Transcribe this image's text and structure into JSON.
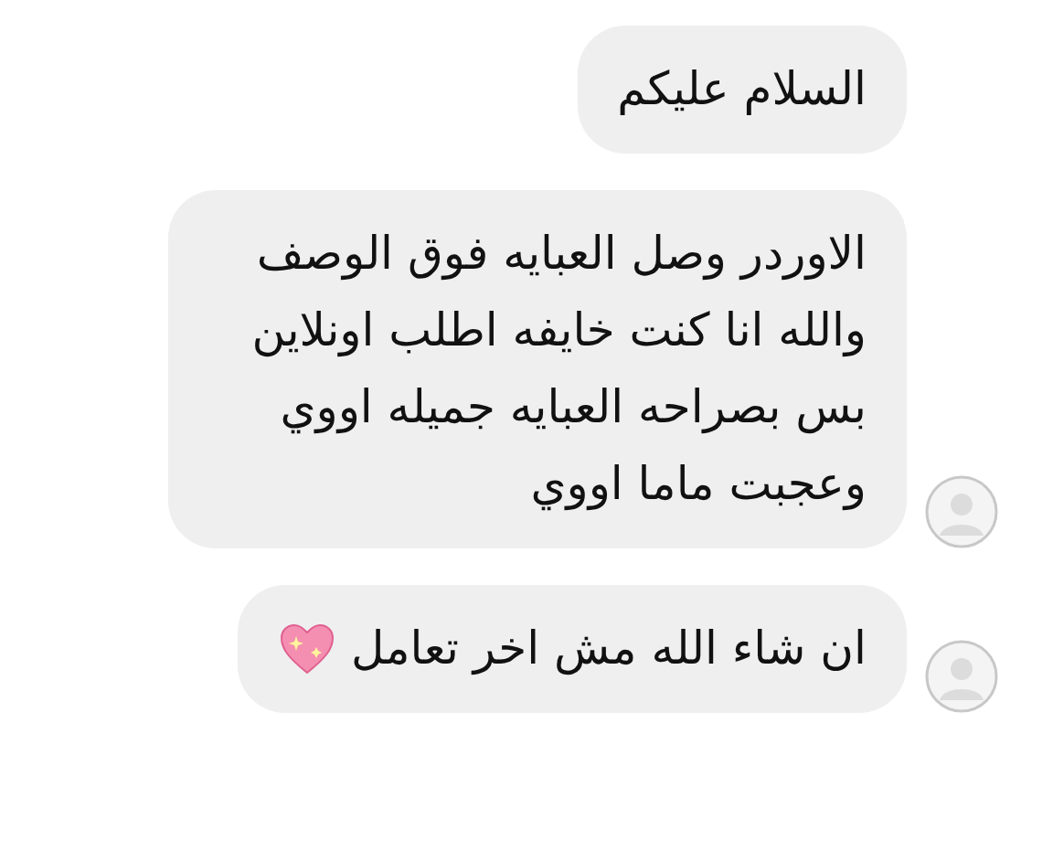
{
  "messages": [
    {
      "text": "السلام عليكم",
      "avatar": false,
      "emoji": false
    },
    {
      "text": "الاوردر وصل العبايه فوق الوصف والله انا كنت خايفه اطلب اونلاين بس بصراحه العبايه جميله اووي وعجبت ماما اووي",
      "avatar": true,
      "emoji": false
    },
    {
      "text": "ان شاء الله مش اخر تعامل",
      "avatar": true,
      "emoji": true
    }
  ]
}
